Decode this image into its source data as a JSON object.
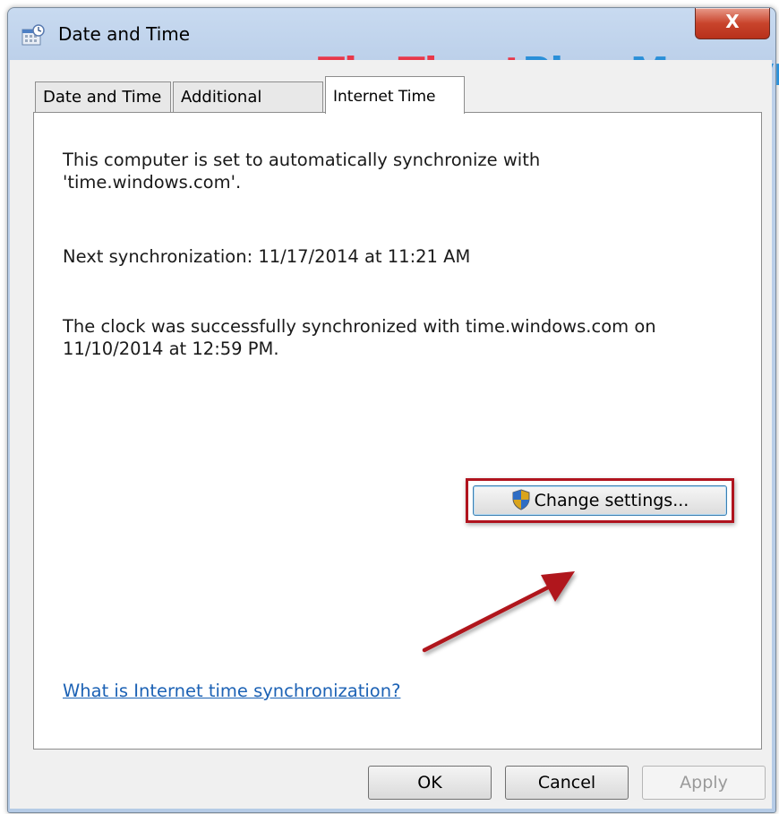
{
  "window": {
    "title": "Date and Time",
    "close_label": "X"
  },
  "watermark": {
    "part1": "ThuThuat",
    "part2": "PhanMem.vn"
  },
  "tabs": [
    {
      "label": "Date and Time"
    },
    {
      "label": "Additional Clocks"
    },
    {
      "label": "Internet Time"
    }
  ],
  "panel": {
    "sync_line1": "This computer is set to automatically synchronize with",
    "sync_line2": "'time.windows.com'.",
    "next_sync": "Next synchronization: 11/17/2014 at 11:21 AM",
    "status_line1": "The clock was successfully synchronized with time.windows.com on",
    "status_line2": "11/10/2014 at 12:59 PM.",
    "change_settings_label": "Change settings...",
    "help_link": "What is Internet time synchronization?"
  },
  "buttons": {
    "ok": "OK",
    "cancel": "Cancel",
    "apply": "Apply"
  },
  "colors": {
    "highlight_box": "#b0141e",
    "annotation_arrow": "#b0141e",
    "link": "#1c62b5"
  }
}
